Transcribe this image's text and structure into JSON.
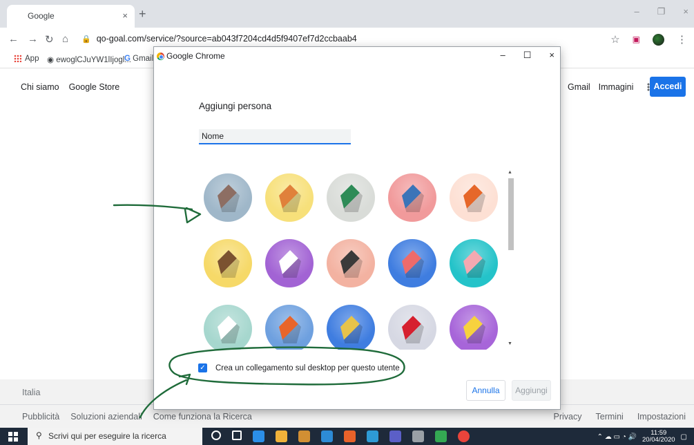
{
  "browser": {
    "tab_title": "Google",
    "tab_close": "×",
    "new_tab": "+",
    "url": "qo-goal.com/service/?source=ab043f7204cd4d5f9407ef7d2ccbaab4",
    "window_controls": [
      "–",
      "❐",
      "×"
    ],
    "bookmarks": [
      {
        "label": "App",
        "icon": "apps-icon"
      },
      {
        "label": "ewoglCJuYW1lIjogl...",
        "icon": "globe-icon"
      },
      {
        "label": "Gmail",
        "icon": "google-icon"
      }
    ]
  },
  "page": {
    "top_left_links": [
      "Chi siamo",
      "Google Store"
    ],
    "top_right_links": [
      "Gmail",
      "Immagini"
    ],
    "signin_label": "Accedi",
    "footer_country": "Italia",
    "footer_left_links": [
      "Pubblicità",
      "Soluzioni aziendali",
      "Come funziona la Ricerca"
    ],
    "footer_right_links": [
      "Privacy",
      "Termini",
      "Impostazioni"
    ]
  },
  "dialog": {
    "window_title": "Google Chrome",
    "controls": [
      "–",
      "☐",
      "×"
    ],
    "heading": "Aggiungi persona",
    "name_placeholder": "Nome",
    "checkbox_label": "Crea un collegamento sul desktop per questo utente",
    "checkbox_checked": true,
    "cancel_label": "Annulla",
    "add_label": "Aggiungi",
    "avatars": [
      {
        "name": "cat",
        "bg": "#9fb7c9",
        "fg": "#8d6e63"
      },
      {
        "name": "corgi",
        "bg": "#f7e07a",
        "fg": "#e0813b"
      },
      {
        "name": "dragon",
        "bg": "#d9dcd8",
        "fg": "#2e8b57"
      },
      {
        "name": "elephant",
        "bg": "#f19a9b",
        "fg": "#3b74b8"
      },
      {
        "name": "fox",
        "bg": "#fde0d4",
        "fg": "#e6672a"
      },
      {
        "name": "monkey",
        "bg": "#f6d968",
        "fg": "#7b5230"
      },
      {
        "name": "panda",
        "bg": "#a263d4",
        "fg": "#ffffff"
      },
      {
        "name": "penguin",
        "bg": "#f3b2a1",
        "fg": "#3a3a3a"
      },
      {
        "name": "butterfly",
        "bg": "#3f7de0",
        "fg": "#ee6b6b"
      },
      {
        "name": "rabbit",
        "bg": "#24c3c9",
        "fg": "#f4a9b1"
      },
      {
        "name": "unicorn",
        "bg": "#a6d7ce",
        "fg": "#ffffff"
      },
      {
        "name": "basketball",
        "bg": "#6ea0df",
        "fg": "#e8652b"
      },
      {
        "name": "bicycle",
        "bg": "#3f7de0",
        "fg": "#e7c34a"
      },
      {
        "name": "bird",
        "bg": "#d6d8e3",
        "fg": "#d6202f"
      },
      {
        "name": "cheese",
        "bg": "#a765d9",
        "fg": "#f7d23e"
      }
    ]
  },
  "taskbar": {
    "search_placeholder": "Scrivi qui per eseguire la ricerca",
    "time": "11:59",
    "date": "20/04/2020",
    "app_colors": [
      "#ffffff",
      "#ffffff",
      "#2b8fe8",
      "#f0b23a",
      "#d28f33",
      "#2d8bd6",
      "#e8622a",
      "#2e9bd6",
      "#5b5fc7",
      "#9aa0a6",
      "#34a853",
      "#e9443b"
    ]
  },
  "colors": {
    "accent": "#1a73e8",
    "annotation": "#1f6b3a"
  }
}
